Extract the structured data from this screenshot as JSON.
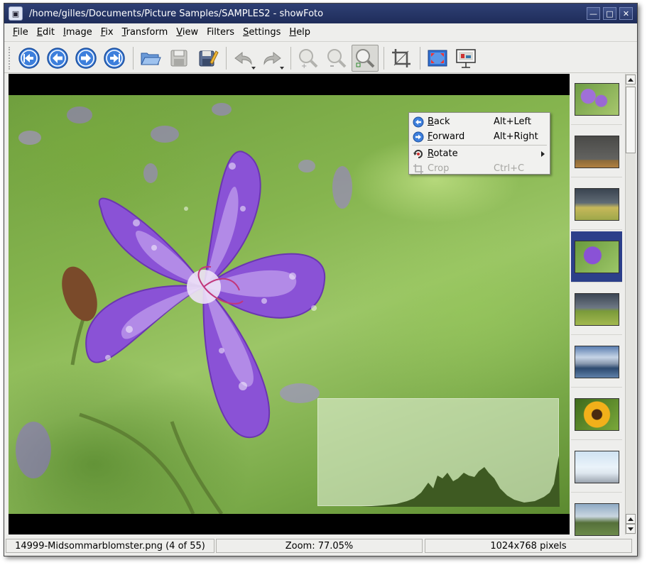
{
  "window": {
    "title": "/home/gilles/Documents/Picture Samples/SAMPLES2 - showFoto",
    "controls": [
      "minimize",
      "maximize",
      "close"
    ]
  },
  "menubar": {
    "items": [
      {
        "label": "File",
        "mnemonic": "F",
        "rest": "ile"
      },
      {
        "label": "Edit",
        "mnemonic": "E",
        "rest": "dit"
      },
      {
        "label": "Image",
        "mnemonic": "I",
        "rest": "mage"
      },
      {
        "label": "Fix",
        "mnemonic": "F",
        "rest": "ix"
      },
      {
        "label": "Transform",
        "mnemonic": "T",
        "rest": "ransform"
      },
      {
        "label": "View",
        "mnemonic": "V",
        "rest": "iew"
      },
      {
        "label": "Filters",
        "mnemonic": "",
        "rest": "Filters"
      },
      {
        "label": "Settings",
        "mnemonic": "S",
        "rest": "ettings"
      },
      {
        "label": "Help",
        "mnemonic": "H",
        "rest": "elp"
      }
    ]
  },
  "toolbar": {
    "buttons": [
      {
        "icon": "first-icon"
      },
      {
        "icon": "back-icon"
      },
      {
        "icon": "forward-icon"
      },
      {
        "icon": "last-icon"
      },
      {
        "icon": "open-folder-icon"
      },
      {
        "icon": "save-icon"
      },
      {
        "icon": "save-as-icon"
      },
      {
        "icon": "undo-icon"
      },
      {
        "icon": "redo-icon"
      },
      {
        "icon": "zoom-in-icon"
      },
      {
        "icon": "zoom-out-icon"
      },
      {
        "icon": "zoom-fit-icon"
      },
      {
        "icon": "crop-icon"
      },
      {
        "icon": "fullscreen-icon"
      },
      {
        "icon": "slideshow-icon"
      }
    ]
  },
  "context_menu": {
    "items": [
      {
        "mnemonic": "B",
        "rest": "ack",
        "shortcut": "Alt+Left",
        "icon": "back-icon",
        "enabled": true
      },
      {
        "mnemonic": "F",
        "rest": "orward",
        "shortcut": "Alt+Right",
        "icon": "forward-icon",
        "enabled": true
      },
      {
        "mnemonic": "R",
        "rest": "otate",
        "shortcut": "",
        "icon": "rotate-icon",
        "enabled": true,
        "submenu": true
      },
      {
        "mnemonic": "",
        "rest": "Crop",
        "shortcut": "Ctrl+C",
        "icon": "crop-icon",
        "enabled": false
      }
    ]
  },
  "thumbnails": {
    "selected_index": 3,
    "items": [
      {
        "subject": "purple flowers"
      },
      {
        "subject": "dark sky"
      },
      {
        "subject": "storm over field"
      },
      {
        "subject": "purple flower"
      },
      {
        "subject": "green meadow"
      },
      {
        "subject": "mountain lake"
      },
      {
        "subject": "sunflower"
      },
      {
        "subject": "penguins on ice"
      },
      {
        "subject": "river valley"
      }
    ]
  },
  "colors": {
    "titlebar": "#2e3f74",
    "selection": "#2c3f8a",
    "petal": "#8a52d6"
  },
  "statusbar": {
    "filename": "14999-Midsommarblomster.png (4 of 55)",
    "zoom": "Zoom: 77.05%",
    "dimensions": "1024x768 pixels"
  }
}
